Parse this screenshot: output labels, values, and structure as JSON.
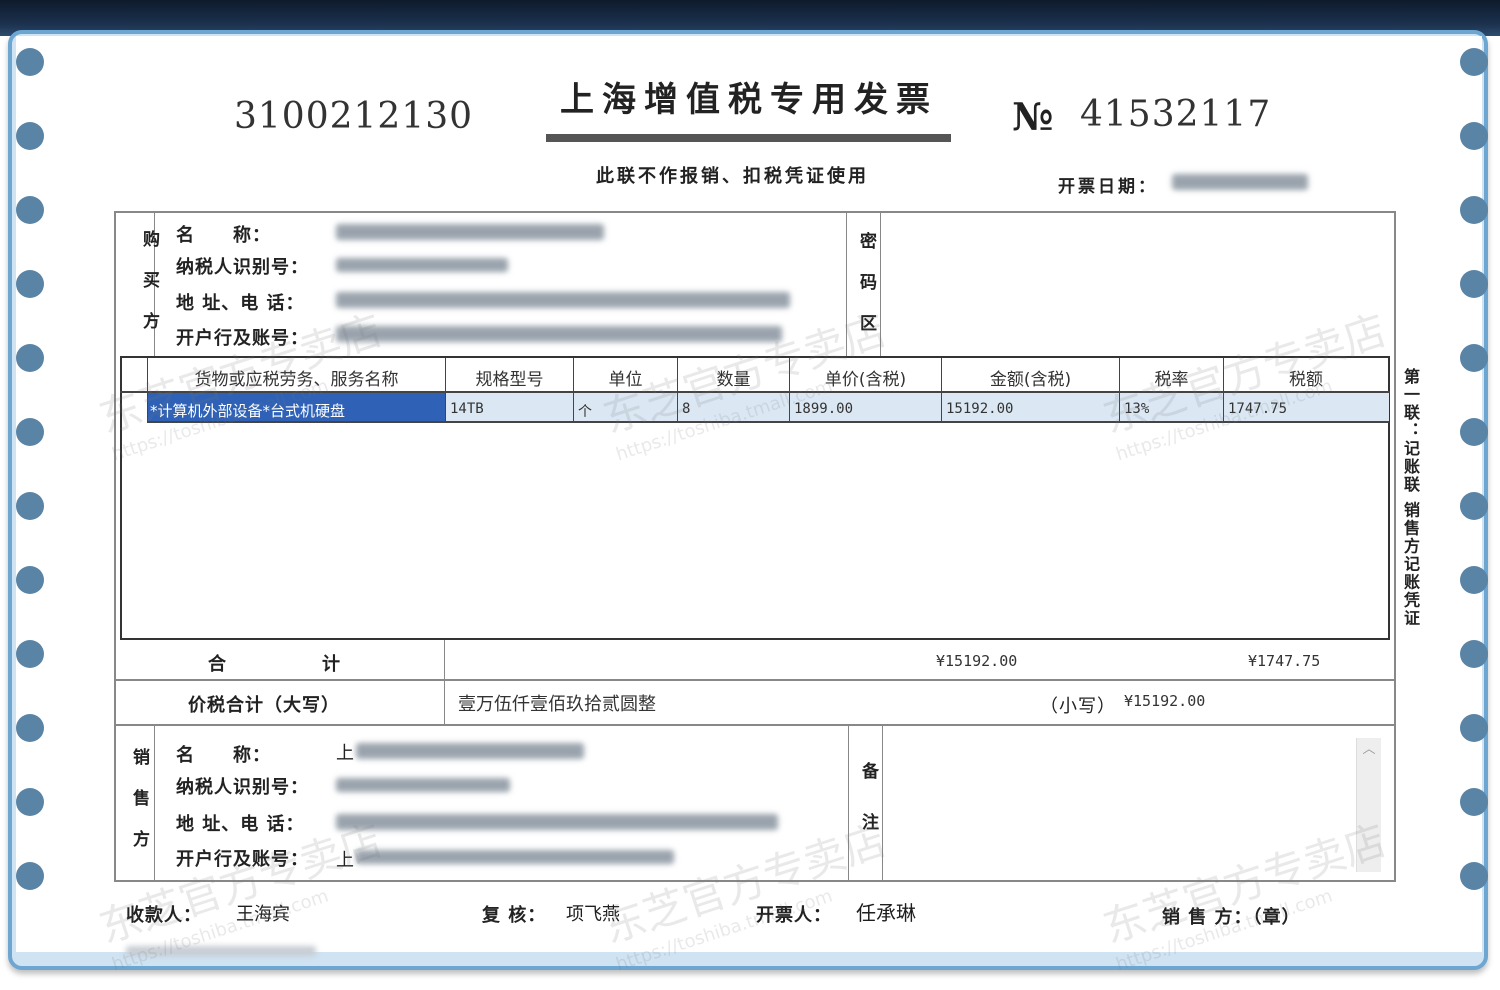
{
  "invoice": {
    "code": "3100212130",
    "title": "上海增值税专用发票",
    "no_mark": "№",
    "number": "41532117",
    "subtitle": "此联不作报销、扣税凭证使用",
    "date_label": "开票日期："
  },
  "buyer": {
    "side_label": "购买方",
    "name_label": "名　　称：",
    "taxid_label": "纳税人识别号：",
    "address_label": "地 址、电 话：",
    "bank_label": "开户行及账号："
  },
  "cipher_label": "密码区",
  "items": {
    "headers": [
      "货物或应税劳务、服务名称",
      "规格型号",
      "单位",
      "数量",
      "单价(含税)",
      "金额(含税)",
      "税率",
      "税额"
    ],
    "rows": [
      [
        "*计算机外部设备*台式机硬盘",
        "14TB",
        "个",
        "8",
        "1899.00",
        "15192.00",
        "13%",
        "1747.75"
      ]
    ]
  },
  "totals": {
    "label": "合　　　　　计",
    "amount": "¥15192.00",
    "tax": "¥1747.75",
    "grand_label": "价税合计（大写）",
    "grand_words": "壹万伍仟壹佰玖拾贰圆整",
    "grand_small_label": "（小写）",
    "grand_small": "¥15192.00"
  },
  "seller": {
    "side_label": "销售方",
    "name_label": "名　　称：",
    "name_prefix": "上",
    "taxid_label": "纳税人识别号：",
    "address_label": "地 址、电 话：",
    "bank_label": "开户行及账号：",
    "bank_prefix": "上"
  },
  "remarks_label": "备注",
  "side_note": "第一联：记账联 销售方记账凭证",
  "footer": {
    "payee_label": "收款人：",
    "payee": "王海宾",
    "reviewer_label": "复 核：",
    "reviewer": "项飞燕",
    "issuer_label": "开票人：",
    "issuer": "任承琳",
    "seller_label": "销 售 方：（章）"
  },
  "watermark": {
    "text": "东芝官方专卖店",
    "url": "https://toshiba.tmall.com"
  }
}
